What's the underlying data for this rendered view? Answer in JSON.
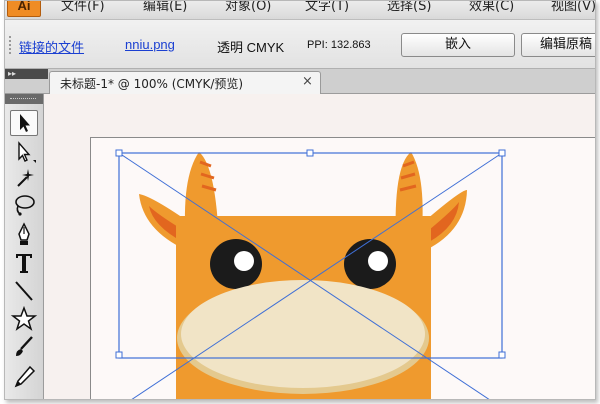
{
  "app": {
    "logo": "Ai"
  },
  "menu": [
    "文件(F)",
    "编辑(E)",
    "对象(O)",
    "文字(T)",
    "选择(S)",
    "效果(C)",
    "视图(V)"
  ],
  "controlbar": {
    "linked_file_label": "链接的文件",
    "file_name": "nniu.png",
    "color_info": "透明 CMYK",
    "ppi_info": "PPI: 132.863",
    "embed_button": "嵌入",
    "edit_original_button": "编辑原稿"
  },
  "tab": {
    "title": "未标题-1* @ 100% (CMYK/预览)",
    "close": "×"
  },
  "icons": {
    "panel_collapse": "double-arrow-icon",
    "tools": [
      "selection-tool-icon",
      "direct-selection-tool-icon",
      "magic-wand-tool-icon",
      "lasso-tool-icon",
      "pen-tool-icon",
      "type-tool-icon",
      "line-segment-tool-icon",
      "star-tool-icon",
      "paintbrush-tool-icon",
      "pencil-tool-icon"
    ]
  },
  "colors": {
    "cow_body": "#ef9a2e",
    "cow_ear_inner": "#e2661f",
    "muzzle": "#f1e4c6",
    "muzzle_shadow": "#e4c98e",
    "eye": "#1b1b1b",
    "selection": "#3f6fd6",
    "accent_orange": "#ef8c25"
  }
}
